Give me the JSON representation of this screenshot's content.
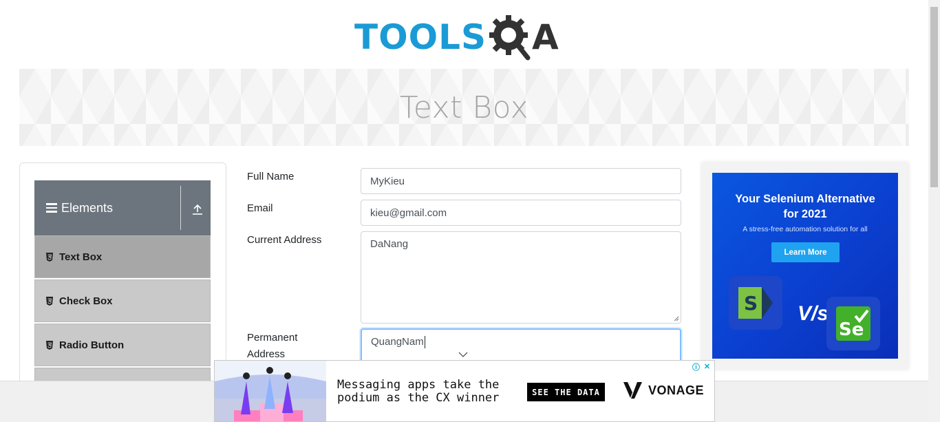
{
  "header": {
    "logo_text": "TOOLS",
    "logo_suffix": "A"
  },
  "banner": {
    "title": "Text Box"
  },
  "sidebar": {
    "group_title": "Elements",
    "items": [
      {
        "label": "Text Box",
        "active": true
      },
      {
        "label": "Check Box",
        "active": false
      },
      {
        "label": "Radio Button",
        "active": false
      }
    ]
  },
  "form": {
    "full_name": {
      "label": "Full Name",
      "value": "MyKieu"
    },
    "email": {
      "label": "Email",
      "value": "kieu@gmail.com"
    },
    "current_address": {
      "label": "Current Address",
      "value": "DaNang"
    },
    "permanent_address": {
      "label_line1": "Permanent",
      "label_line2": "Address",
      "value": "QuangNam"
    }
  },
  "ad_right": {
    "headline_line1": "Your Selenium Alternative",
    "headline_line2": "for 2021",
    "subtext": "A stress-free automation solution for all",
    "button_label": "Learn More",
    "vs_text": "V/s"
  },
  "ad_bottom": {
    "message_line1": "Messaging apps take the",
    "message_line2": "podium as the CX winner",
    "cta_label": "SEE THE DATA",
    "brand": "VONAGE"
  },
  "colors": {
    "brand_blue": "#1a9bd6",
    "sidebar_header": "#6c757d",
    "focus_border": "#80bdff",
    "ad_blue": "#0b3fcf"
  }
}
